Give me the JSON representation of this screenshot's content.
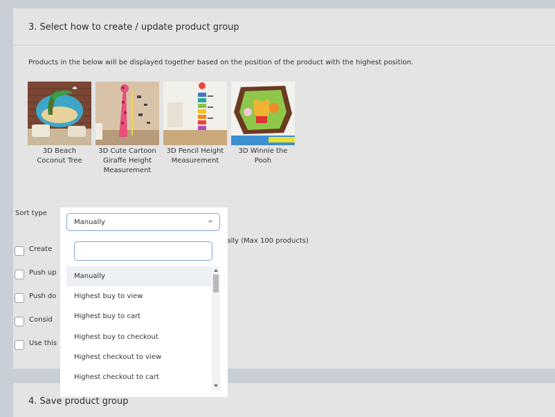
{
  "section3": {
    "title": "3. Select how to create / update product group",
    "description": "Products in the below will be displayed together based on the position of the product with the highest position.",
    "products": [
      {
        "name": "3D Beach Coconut Tree",
        "image": "beach-coconut-tree-photo"
      },
      {
        "name": "3D Cute Cartoon Giraffe Height Measurement",
        "image": "giraffe-height-measurement-photo"
      },
      {
        "name": "3D Pencil Height Measurement",
        "image": "pencil-height-measurement-photo"
      },
      {
        "name": "3D Winnie the Pooh",
        "image": "winnie-the-pooh-photo"
      }
    ],
    "sort_label": "Sort type",
    "options": [
      {
        "label": "Create"
      },
      {
        "label": "Push up"
      },
      {
        "label": "Push do"
      },
      {
        "label": "Consid"
      },
      {
        "label": "Use this"
      }
    ],
    "option_tail": "cally (Max 100 products)"
  },
  "sort_dropdown": {
    "selected": "Manually",
    "search_value": "",
    "items": [
      "Manually",
      "Highest buy to view",
      "Highest buy to cart",
      "Highest buy to checkout",
      "Highest checkout to view",
      "Highest checkout to cart"
    ]
  },
  "section4": {
    "title": "4. Save product group"
  },
  "colors": {
    "page_bg": "#c9cfd7",
    "card_bg": "#e4e4e4",
    "focus_border": "#7ea3d6",
    "selected_item_bg": "#edf0f4"
  }
}
